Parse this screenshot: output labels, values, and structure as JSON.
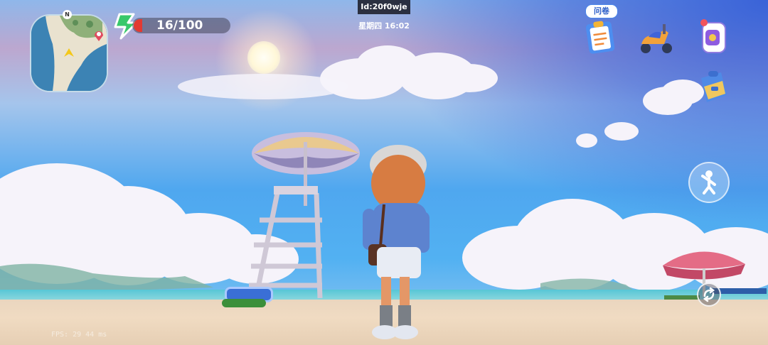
{
  "hud": {
    "energy": "16/100",
    "session_id": "Id:20f0wje",
    "clock": "星期四 16:02",
    "questionnaire_label": "问卷",
    "fps": "FPS: 29  44 ms"
  },
  "minimap": {
    "north_label": "N"
  },
  "colors": {
    "energy_low": "#e23a32",
    "energy_icon": "#38c86b",
    "tag_border": "#4d86e8"
  },
  "icons": {
    "questionnaire": "clipboard-icon",
    "vehicle": "scooter-icon",
    "phone": "watch-phone-icon",
    "backpack": "backpack-icon",
    "emote": "dance-pose-icon",
    "switch": "swap-arrows-icon"
  }
}
